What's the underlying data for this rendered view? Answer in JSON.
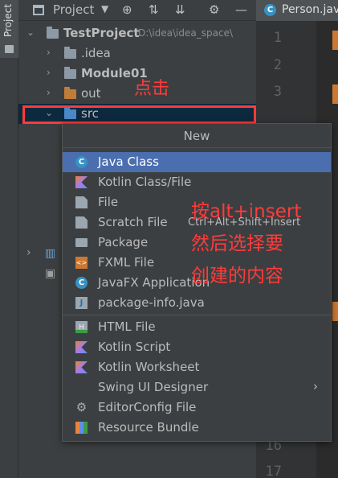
{
  "sidebar": {
    "label": "Project"
  },
  "panel": {
    "title": "Project",
    "tools": {
      "target": "⊕",
      "expand": "⇅",
      "collapse": "⇊",
      "settings": "⚙",
      "hide": "—"
    }
  },
  "tree": {
    "root": {
      "name": "TestProject",
      "path": "D:\\idea\\idea_space\\"
    },
    "items": [
      {
        "name": ".idea"
      },
      {
        "name": "Module01"
      },
      {
        "name": "out"
      },
      {
        "name": "src"
      }
    ]
  },
  "annotations": {
    "click": "点击",
    "instruction_line1": "按alt+insert",
    "instruction_line2": "然后选择要",
    "instruction_line3": "创建的内容"
  },
  "editor": {
    "tab": "Person.java",
    "tab_icon": "C",
    "line_numbers": [
      "1",
      "2",
      "3",
      "16",
      "17"
    ]
  },
  "popup": {
    "title": "New",
    "items": [
      {
        "label": "Java Class",
        "icon": "class-icon",
        "glyph": "C"
      },
      {
        "label": "Kotlin Class/File",
        "icon": "kotlin-icon",
        "glyph": ""
      },
      {
        "label": "File",
        "icon": "file-icon",
        "glyph": ""
      },
      {
        "label": "Scratch File",
        "icon": "scratch-file-icon",
        "glyph": "",
        "shortcut": "Ctrl+Alt+Shift+Insert"
      },
      {
        "label": "Package",
        "icon": "package-icon",
        "glyph": ""
      },
      {
        "label": "FXML File",
        "icon": "fxml-icon",
        "glyph": "<>"
      },
      {
        "label": "JavaFX Application",
        "icon": "javafx-icon",
        "glyph": "C"
      },
      {
        "label": "package-info.java",
        "icon": "java-file-icon",
        "glyph": "J"
      },
      {
        "label": "HTML File",
        "icon": "html-icon",
        "glyph": "H"
      },
      {
        "label": "Kotlin Script",
        "icon": "kotlin-script-icon",
        "glyph": ""
      },
      {
        "label": "Kotlin Worksheet",
        "icon": "kotlin-worksheet-icon",
        "glyph": ""
      },
      {
        "label": "Swing UI Designer",
        "icon": "",
        "glyph": "",
        "submenu": "›"
      },
      {
        "label": "EditorConfig File",
        "icon": "gear-icon",
        "glyph": "⚙"
      },
      {
        "label": "Resource Bundle",
        "icon": "resource-bundle-icon",
        "glyph": ""
      }
    ]
  },
  "colors": {
    "highlight": "#4b6eaf",
    "annotation": "#ff3b3b",
    "selection": "#0d293e"
  }
}
